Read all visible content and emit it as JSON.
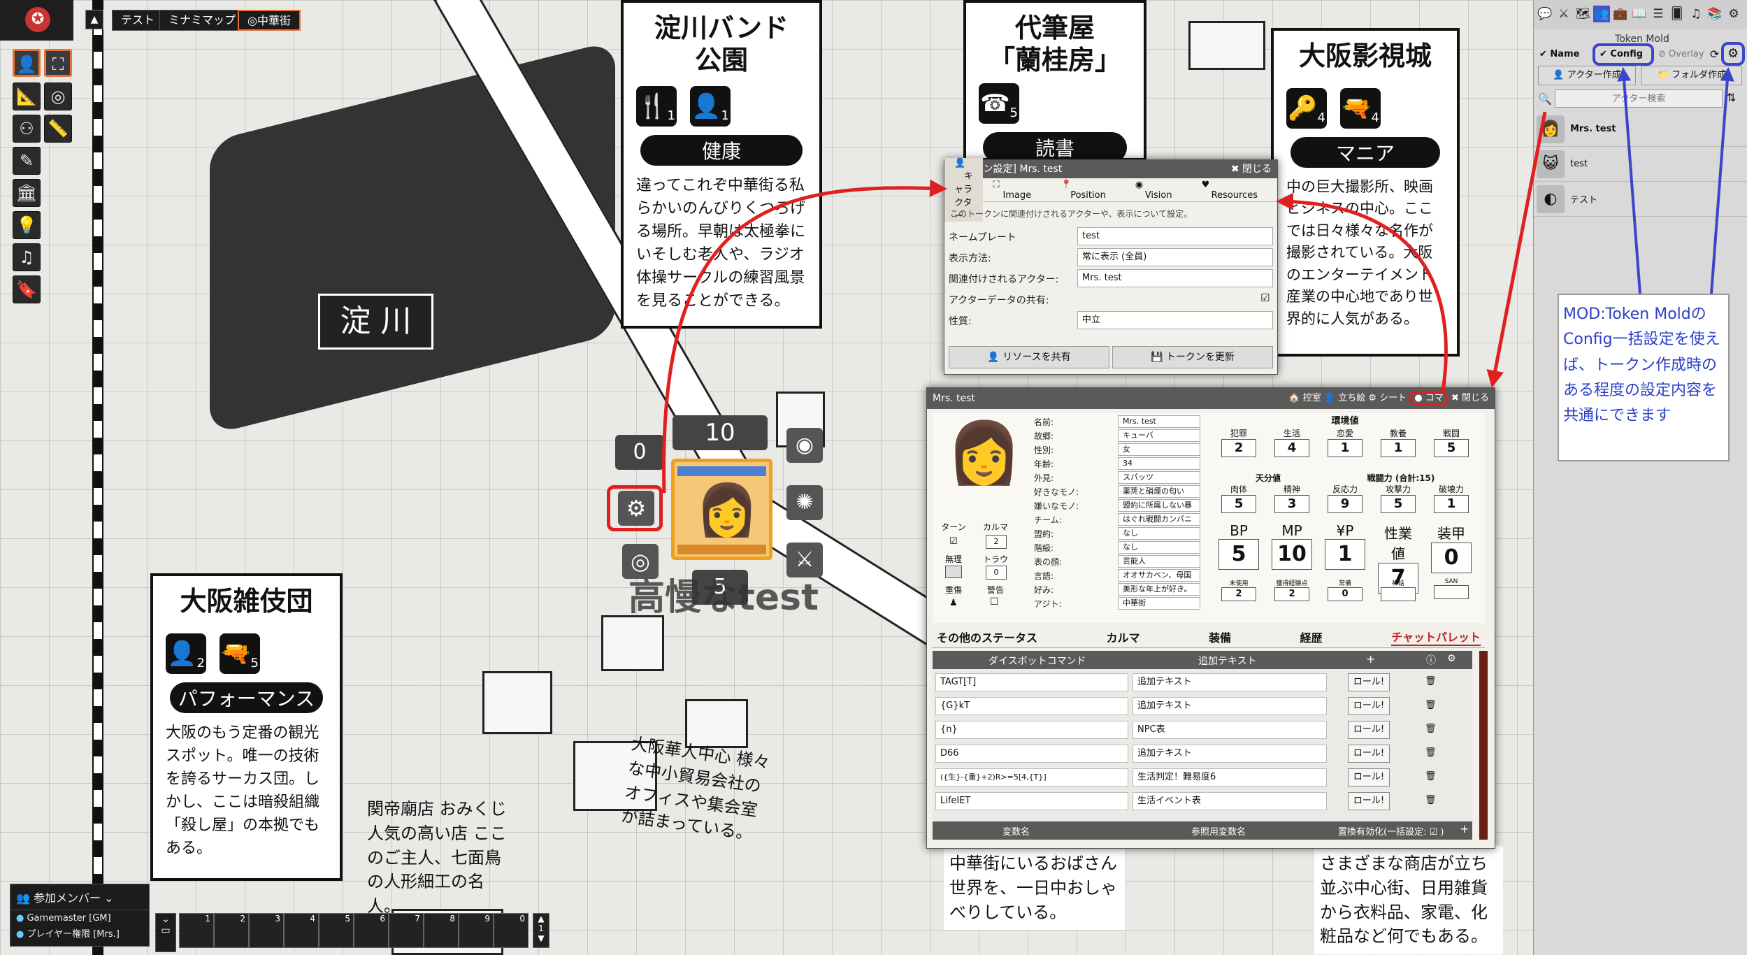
{
  "toolbar": {
    "scene_tabs": [
      "テスト",
      "ミナミマップ",
      "◎中華街"
    ]
  },
  "map": {
    "bubble_yodogawa": {
      "title_l1": "淀川バンド",
      "title_l2": "公園",
      "icon1": "🍴",
      "icon1_n": "1",
      "icon2": "👤",
      "icon2_n": "1",
      "tag": "健康",
      "body": "違ってこれぞ中華街る私らかいのんびりくつろげる場所。早朝は太極拳にいそしむ老人や、ラジオ体操サークルの練習風景を見ることができる。"
    },
    "bubble_daihitsu": {
      "title_l1": "代筆屋",
      "title_l2": "「蘭桂房」",
      "icon1": "☎",
      "icon1_n": "5",
      "tag": "読書"
    },
    "bubble_eishijo": {
      "title": "大阪影視城",
      "icon1": "🔑",
      "icon1_n": "4",
      "icon2": "🔫",
      "icon2_n": "4",
      "tag": "マニア",
      "body": "中の巨大撮影所、映画ビジネスの中心。ここでは日々様々な名作が撮影されている。大阪のエンターテイメント産業の中心地であり世界的に人気がある。"
    },
    "bubble_zatsugi": {
      "title": "大阪雑伎団",
      "icon1": "👤",
      "icon1_n": "2",
      "icon2": "🔫",
      "icon2_n": "5",
      "tag": "パフォーマンス",
      "body": "大阪のもう定番の観光スポット。唯一の技術を誇るサーカス団。しかし、ここは暗殺組織「殺し屋」の本拠でもある。"
    },
    "river_label": "淀 川",
    "note_shrine": "関帝廟店 おみくじ人気の高い店 ここのご主人、七面鳥の人形細工の名人。",
    "note_center": "大阪華人中心 様々な中小貿易会社のオフィスや集会室が詰まっている。",
    "note_bottom1": "中華街にいるおばさん 世界を、一日中おしゃべりしている。",
    "note_bottom2": "さまざまな商店が立ち並ぶ中心街、日用雑貨から衣料品、家電、化粧品など何でもある。",
    "player_label": "プレイヤー権限"
  },
  "token": {
    "name": "高慢なtest",
    "bar_top": "10",
    "bar_left": "0",
    "bar_bottom": "5"
  },
  "players": {
    "title": "参加メンバー",
    "items": [
      "Gamemaster [GM]",
      "プレイヤー権限 [Mrs.]"
    ]
  },
  "macro_bar": {
    "slots": [
      "1",
      "2",
      "3",
      "4",
      "5",
      "6",
      "7",
      "8",
      "9",
      "0"
    ]
  },
  "sidebar": {
    "title": "Token Mold",
    "filters": {
      "name": "Name",
      "config": "Config",
      "overlay": "Overlay"
    },
    "create_actor": "アクター作成",
    "create_folder": "フォルダ作成",
    "search_placeholder": "アクター検索",
    "actors": [
      {
        "name": "Mrs. test",
        "portrait": "👩"
      },
      {
        "name": "test",
        "portrait": "😺"
      },
      {
        "name": "テスト",
        "portrait": "◐"
      }
    ]
  },
  "token_config": {
    "title": "[トークン設定] Mrs. test",
    "close": "閉じる",
    "tabs": [
      "キャラクター",
      "Image",
      "Position",
      "Vision",
      "Resources"
    ],
    "description": "このトークンに関連付けされるアクターや、表示について設定。",
    "fields": [
      {
        "label": "ネームプレート",
        "value": "test"
      },
      {
        "label": "表示方法:",
        "value": "常に表示 (全員)"
      },
      {
        "label": "関連付けされるアクター:",
        "value": "Mrs. test"
      },
      {
        "label": "アクターデータの共有:",
        "value": "☑"
      },
      {
        "label": "性質:",
        "value": "中立"
      }
    ],
    "btn_share": "リソースを共有",
    "btn_update": "トークンを更新"
  },
  "sheet": {
    "title": "Mrs. test",
    "watermark": "プレイヤー権限",
    "header_buttons": [
      "控室",
      "立ち絵",
      "シート",
      "コマ",
      "閉じる"
    ],
    "profile": [
      {
        "label": "名前:",
        "value": "Mrs. test"
      },
      {
        "label": "故郷:",
        "value": "キューバ"
      },
      {
        "label": "性別:",
        "value": "女"
      },
      {
        "label": "年齢:",
        "value": "34"
      },
      {
        "label": "外見:",
        "value": "スパッツ"
      },
      {
        "label": "好きなモノ:",
        "value": "薬莢と硝煙の匂い"
      },
      {
        "label": "嫌いなモノ:",
        "value": "盟約に所属しない暴"
      },
      {
        "label": "チーム:",
        "value": "はぐれ戦闘カンパニ"
      },
      {
        "label": "盟約:",
        "value": "なし"
      },
      {
        "label": "階級:",
        "value": "なし"
      },
      {
        "label": "表の顔:",
        "value": "芸能人"
      },
      {
        "label": "言語:",
        "value": "オオサカベン、母国"
      },
      {
        "label": "好み:",
        "value": "美形な年上が好き。"
      },
      {
        "label": "アジト:",
        "value": "中華街"
      }
    ],
    "side_labels": {
      "turn": "ターン",
      "karma": "カルマ",
      "karma_val": "2",
      "muri": "無理",
      "trauma": "トラウマ",
      "trauma_val": "0",
      "judo": "重傷",
      "keikoku": "警告"
    },
    "env_title": "環境値",
    "env": [
      {
        "label": "犯罪",
        "value": "2"
      },
      {
        "label": "生活",
        "value": "4"
      },
      {
        "label": "恋愛",
        "value": "1"
      },
      {
        "label": "教養",
        "value": "1"
      },
      {
        "label": "戦闘",
        "value": "5"
      }
    ],
    "talent_title": "天分値",
    "battle_title": "戦闘力 (合計:15)",
    "talent": [
      {
        "label": "肉体",
        "value": "5"
      },
      {
        "label": "精神",
        "value": "3"
      },
      {
        "label": "反応力",
        "value": "9"
      },
      {
        "label": "攻撃力",
        "value": "5"
      },
      {
        "label": "破壊力",
        "value": "1"
      }
    ],
    "big": [
      {
        "label": "BP",
        "value": "5"
      },
      {
        "label": "MP",
        "value": "10"
      },
      {
        "label": "¥P",
        "value": "1"
      },
      {
        "label": "性業値",
        "value": "7"
      },
      {
        "label": "装甲",
        "value": "0"
      }
    ],
    "mini": [
      {
        "label": "未使用",
        "value": "2"
      },
      {
        "label": "獲得経験点",
        "value": "2"
      },
      {
        "label": "常備",
        "value": "0"
      },
      {
        "label": "神話",
        "value": ""
      },
      {
        "label": "SAN",
        "value": ""
      }
    ],
    "section_tabs": [
      "その他のステータス",
      "カルマ",
      "装備",
      "経歴",
      "チャットパレット"
    ],
    "palette_headers": {
      "cmd": "ダイスボットコマンド",
      "text": "追加テキスト"
    },
    "palette": [
      {
        "cmd": "TAGT[T]",
        "text": "追加テキスト",
        "btn": "ロール!"
      },
      {
        "cmd": "{G}kT",
        "text": "追加テキスト",
        "btn": "ロール!"
      },
      {
        "cmd": "{n}",
        "text": "NPC表",
        "btn": "ロール!"
      },
      {
        "cmd": "D66",
        "text": "追加テキスト",
        "btn": "ロール!"
      },
      {
        "cmd": "({生}-{重}+2)R>=5[4,{T}]",
        "text": "生活判定！難易度6",
        "btn": "ロール!"
      },
      {
        "cmd": "LifeIET",
        "text": "生活イベント表",
        "btn": "ロール!"
      }
    ],
    "footer": {
      "var": "変数名",
      "ref": "参照用変数名",
      "enable": "置換有効化(一括設定: ☑ )"
    }
  },
  "annotation": {
    "text": "MOD:Token MoldのConfig一括設定を使えば、トークン作成時のある程度の設定内容を共通にできます"
  },
  "colors": {
    "highlight_red": "#e02020",
    "highlight_blue": "#3a45c8",
    "accent_orange": "#e8703a"
  }
}
